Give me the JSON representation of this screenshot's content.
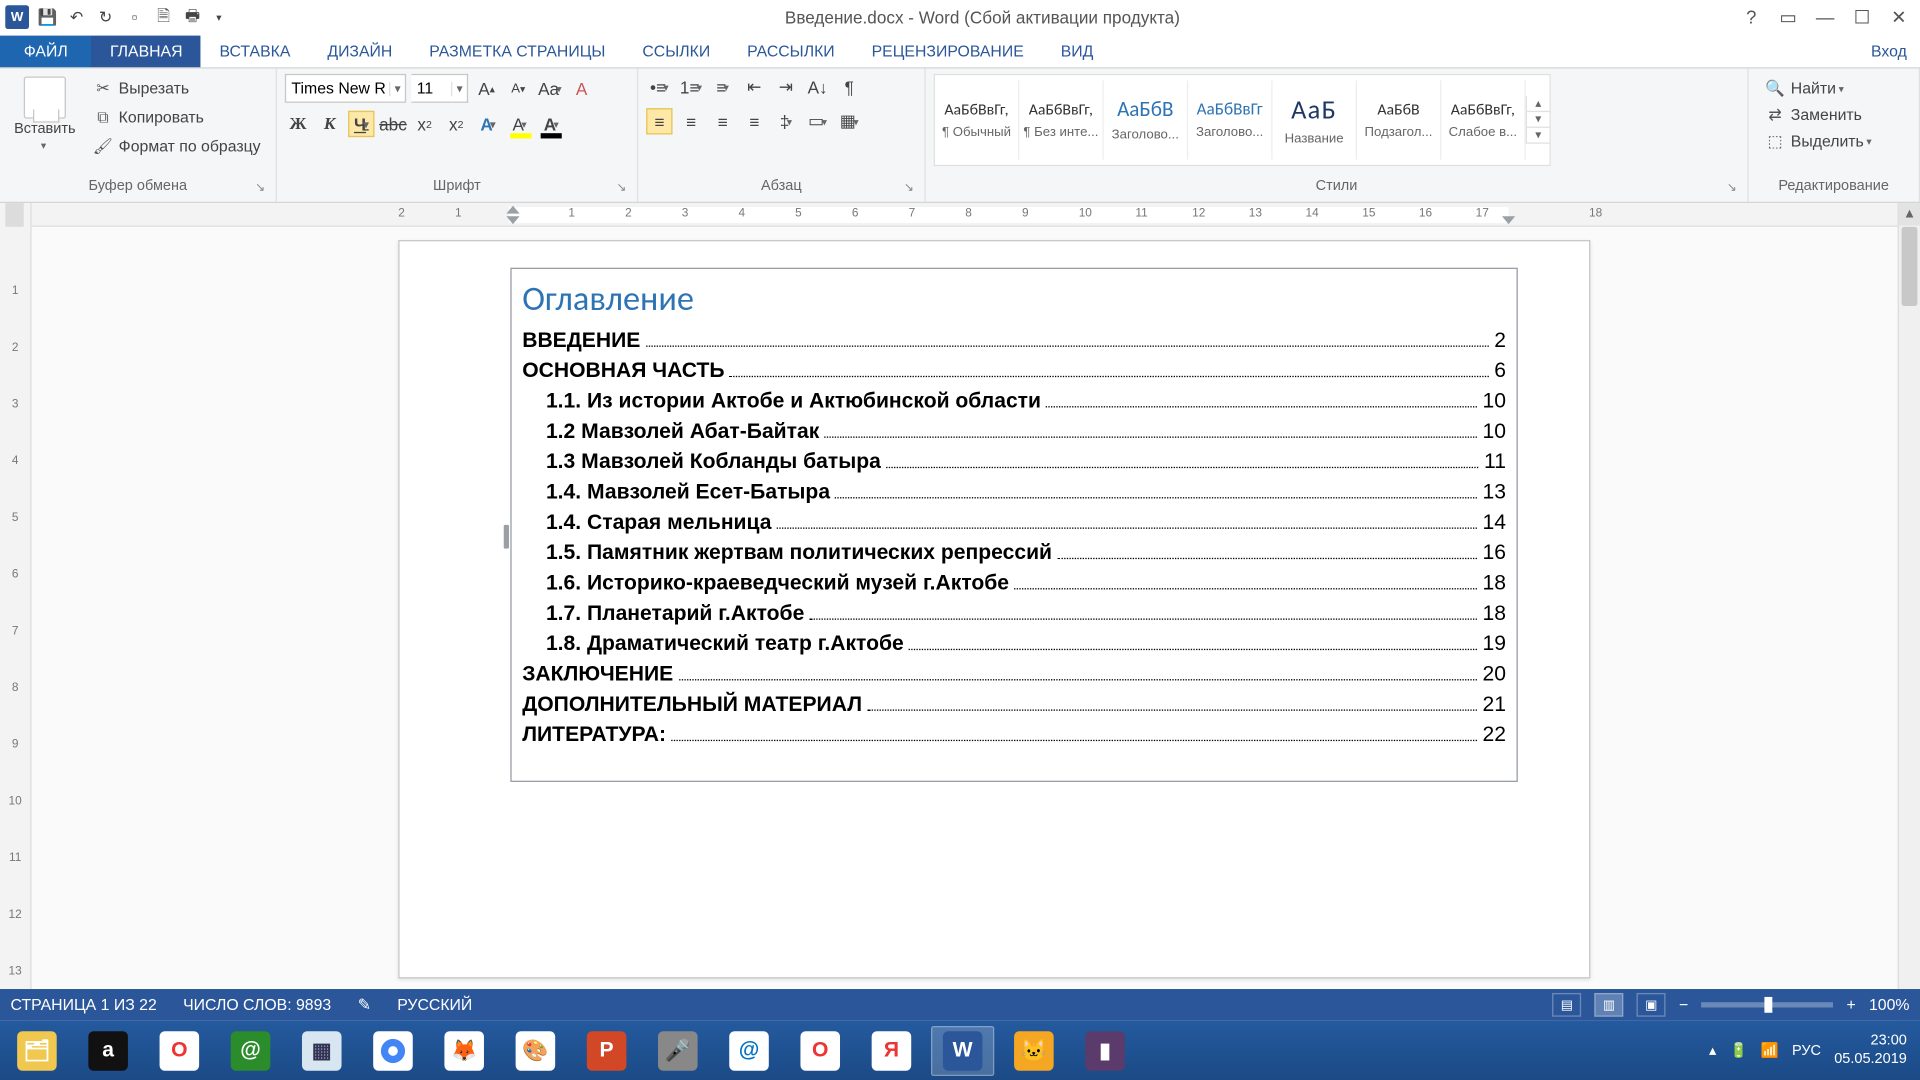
{
  "titlebar": {
    "doc_title": "Введение.docx - Word (Сбой активации продукта)"
  },
  "tabs": {
    "file": "ФАЙЛ",
    "items": [
      "ГЛАВНАЯ",
      "ВСТАВКА",
      "ДИЗАЙН",
      "РАЗМЕТКА СТРАНИЦЫ",
      "ССЫЛКИ",
      "РАССЫЛКИ",
      "РЕЦЕНЗИРОВАНИЕ",
      "ВИД"
    ],
    "active_index": 0,
    "signin": "Вход"
  },
  "ribbon": {
    "clipboard": {
      "label": "Буфер обмена",
      "paste": "Вставить",
      "cut": "Вырезать",
      "copy": "Копировать",
      "format_painter": "Формат по образцу"
    },
    "font": {
      "label": "Шрифт",
      "name": "Times New R",
      "size": "11",
      "bold": "Ж",
      "italic": "К",
      "underline": "Ч",
      "strike": "abc",
      "sub": "x",
      "sup": "x",
      "grow": "A",
      "shrink": "A",
      "case": "Aa",
      "clear": "A"
    },
    "para": {
      "label": "Абзац"
    },
    "styles": {
      "label": "Стили",
      "preview_text": "АаБбВвГг",
      "preview_short": "АаБбВ",
      "preview_title": "АаБ",
      "items": [
        "¶ Обычный",
        "¶ Без инте...",
        "Заголово...",
        "Заголово...",
        "Название",
        "Подзагол...",
        "Слабое в..."
      ]
    },
    "editing": {
      "label": "Редактирование",
      "find": "Найти",
      "replace": "Заменить",
      "select": "Выделить"
    }
  },
  "document": {
    "toc_title": "Оглавление",
    "entries": [
      {
        "text": "ВВЕДЕНИЕ",
        "page": "2",
        "level": 0
      },
      {
        "text": "ОСНОВНАЯ ЧАСТЬ",
        "page": "6",
        "level": 0
      },
      {
        "text": "1.1. Из истории Актобе и Актюбинской области",
        "page": "10",
        "level": 1
      },
      {
        "text": "1.2 Мавзолей Абат-Байтак",
        "page": "10",
        "level": 1
      },
      {
        "text": "1.3 Мавзолей Кобланды батыра",
        "page": "11",
        "level": 1
      },
      {
        "text": "1.4. Мавзолей Есет-Батыра",
        "page": "13",
        "level": 1
      },
      {
        "text": "1.4. Старая мельница",
        "page": "14",
        "level": 1
      },
      {
        "text": "1.5. Памятник жертвам политических репрессий",
        "page": "16",
        "level": 1
      },
      {
        "text": "1.6. Историко-краеведческий музей г.Актобе",
        "page": "18",
        "level": 1
      },
      {
        "text": "1.7. Планетарий г.Актобе",
        "page": "18",
        "level": 1
      },
      {
        "text": "1.8. Драматический театр г.Актобе",
        "page": "19",
        "level": 1
      },
      {
        "text": "ЗАКЛЮЧЕНИЕ",
        "page": "20",
        "level": 0
      },
      {
        "text": "ДОПОЛНИТЕЛЬНЫЙ МАТЕРИАЛ",
        "page": "21",
        "level": 0
      },
      {
        "text": "ЛИТЕРАТУРА:",
        "page": "22",
        "level": 0
      }
    ]
  },
  "ruler": {
    "h_ticks": [
      "2",
      "1",
      "",
      "1",
      "2",
      "3",
      "4",
      "5",
      "6",
      "7",
      "8",
      "9",
      "10",
      "11",
      "12",
      "13",
      "14",
      "15",
      "16",
      "17",
      "",
      "18"
    ]
  },
  "statusbar": {
    "page": "СТРАНИЦА 1 ИЗ 22",
    "words": "ЧИСЛО СЛОВ: 9893",
    "lang": "РУССКИЙ",
    "zoom": "100%"
  },
  "taskbar": {
    "lang": "РУС",
    "time": "23:00",
    "date": "05.05.2019"
  }
}
